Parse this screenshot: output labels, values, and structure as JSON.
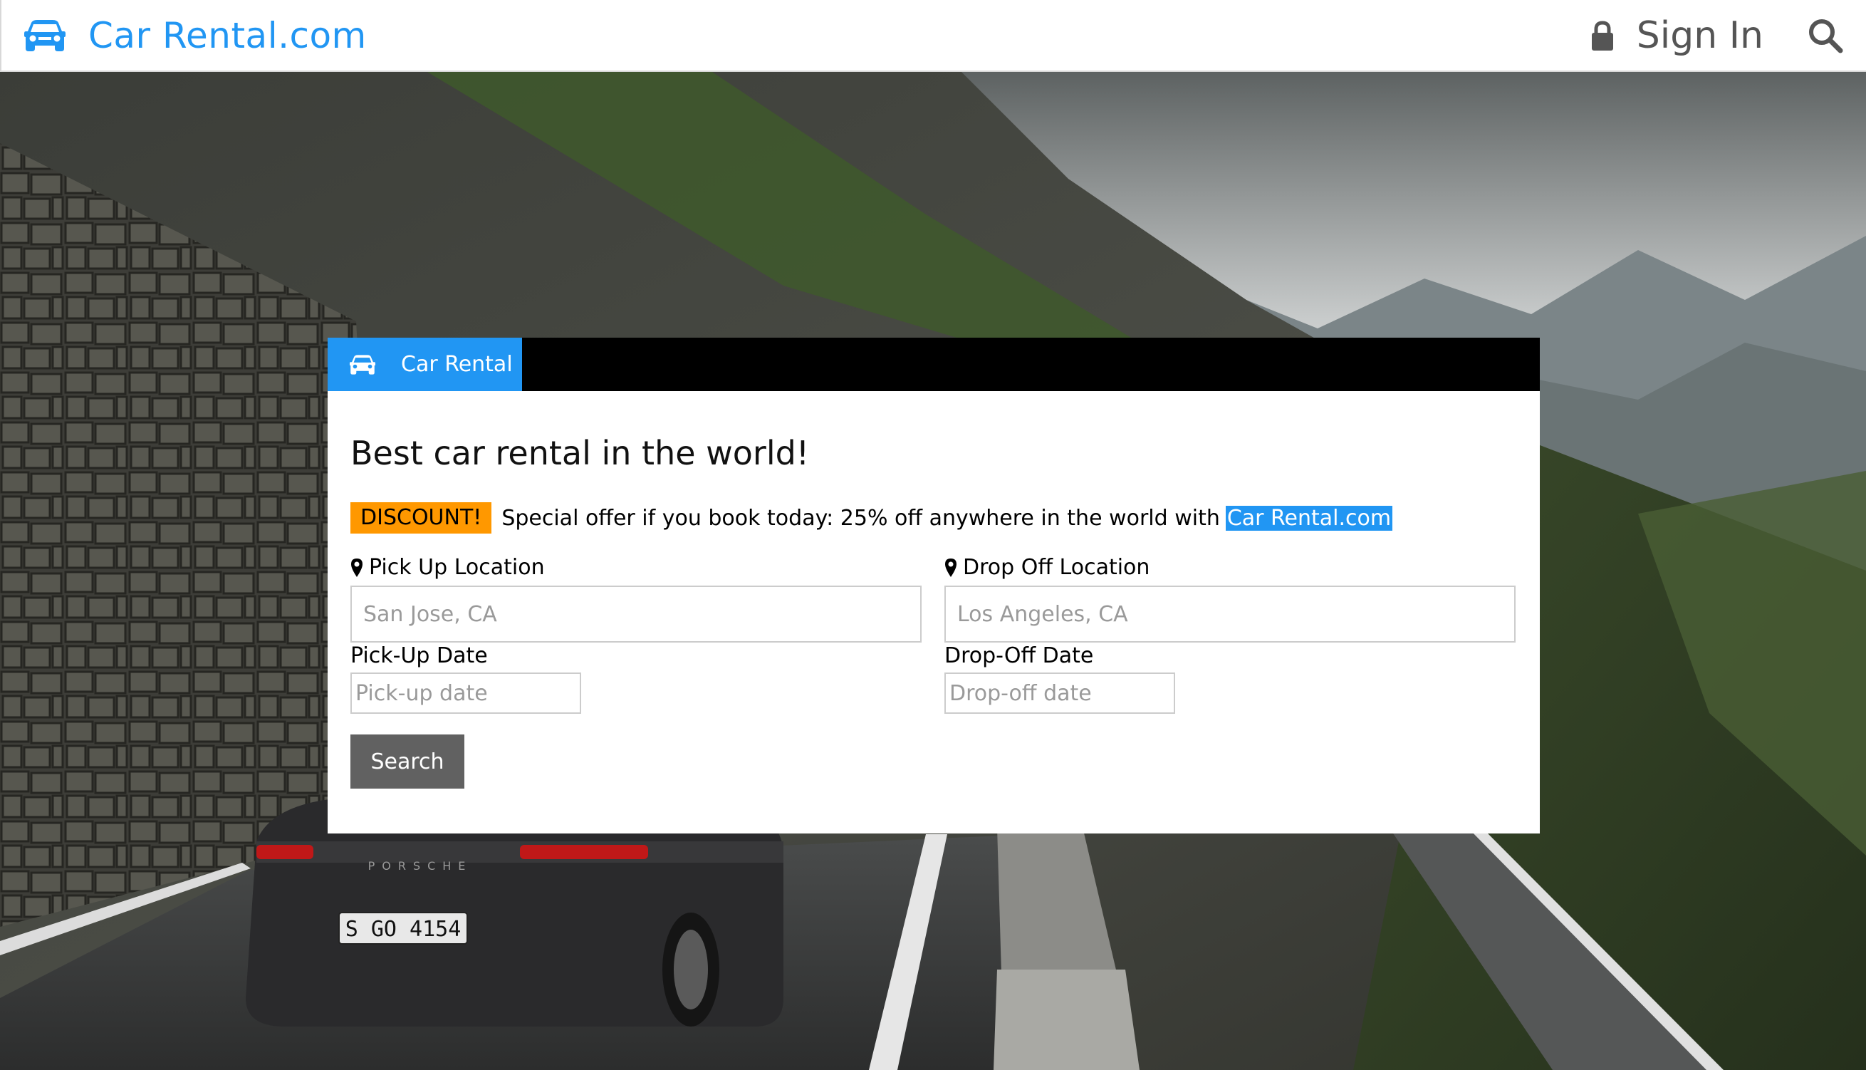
{
  "header": {
    "brand_name": "Car Rental.com",
    "brand_icon": "car-icon",
    "signin_label": "Sign In",
    "signin_icon": "lock-icon",
    "search_icon": "search-icon",
    "brand_color": "#2196F3"
  },
  "booking": {
    "tab_label": "Car Rental",
    "tab_icon": "car-icon",
    "title": "Best car rental in the world!",
    "promo": {
      "badge": "DISCOUNT!",
      "text": "Special offer if you book today: 25% off anywhere in the world with",
      "highlight": "Car Rental.com"
    },
    "pickup_location": {
      "label": "Pick Up Location",
      "placeholder": "San Jose, CA",
      "icon": "map-marker-icon"
    },
    "dropoff_location": {
      "label": "Drop Off Location",
      "placeholder": "Los Angeles, CA",
      "icon": "map-marker-icon"
    },
    "pickup_date": {
      "label": "Pick-Up Date",
      "placeholder": "Pick-up date"
    },
    "dropoff_date": {
      "label": "Drop-Off Date",
      "placeholder": "Drop-off date"
    },
    "search_button": "Search"
  },
  "hero": {
    "license_plate": "S GO 4154",
    "car_badge": "PORSCHE"
  },
  "colors": {
    "accent": "#2196F3",
    "badge": "#FF9800",
    "tabbar": "#000000",
    "button": "#616161"
  }
}
